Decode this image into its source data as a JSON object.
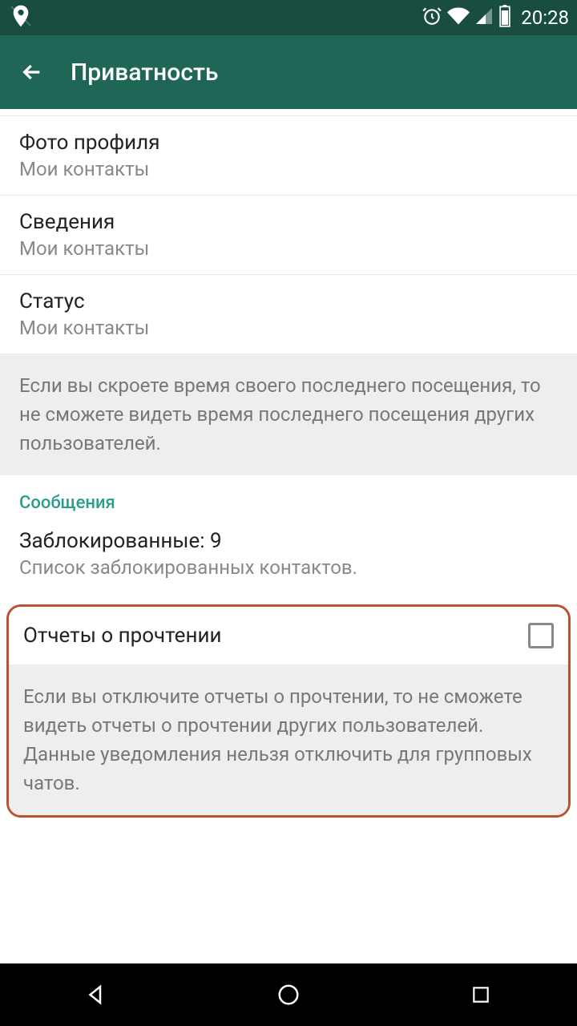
{
  "status": {
    "time": "20:28"
  },
  "appbar": {
    "title": "Приватность"
  },
  "settings": {
    "photo": {
      "title": "Фото профиля",
      "subtitle": "Мои контакты"
    },
    "about": {
      "title": "Сведения",
      "subtitle": "Мои контакты"
    },
    "status": {
      "title": "Статус",
      "subtitle": "Мои контакты"
    }
  },
  "infoLastSeen": "Если вы скроете время своего последнего посещения, то не сможете видеть время последнего посещения других пользователей.",
  "section": {
    "messages": "Сообщения"
  },
  "blocked": {
    "title": "Заблокированные: 9",
    "subtitle": "Список заблокированных контактов."
  },
  "readReceipts": {
    "title": "Отчеты о прочтении",
    "info": "Если вы отключите отчеты о прочтении, то не сможете видеть отчеты о прочтении других пользователей. Данные уведомления нельзя отключить для групповых чатов."
  }
}
